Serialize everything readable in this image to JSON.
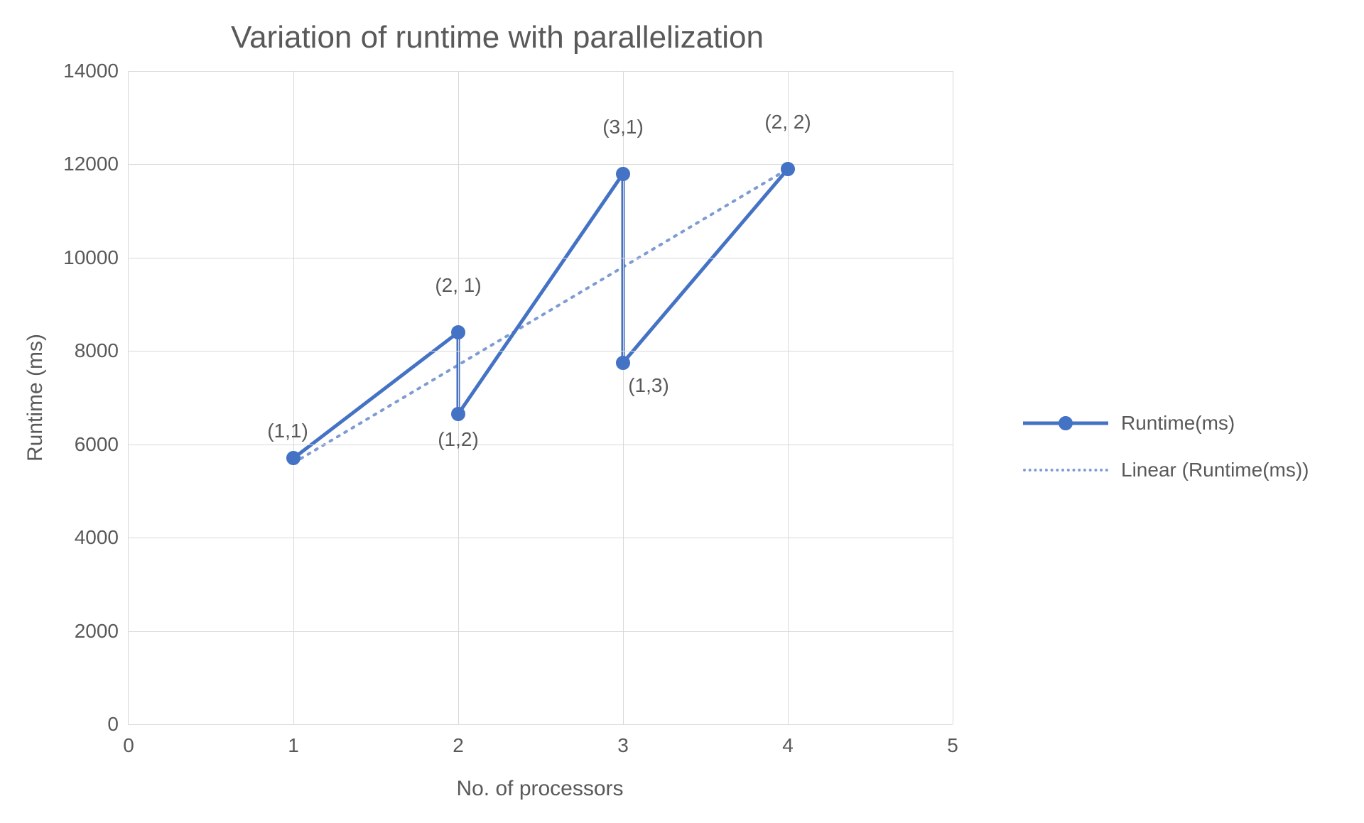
{
  "chart_data": {
    "type": "line",
    "title": "Variation of runtime with parallelization",
    "xlabel": "No. of processors",
    "ylabel": "Runtime (ms)",
    "xlim": [
      0,
      5
    ],
    "ylim": [
      0,
      14000
    ],
    "x_ticks": [
      0,
      1,
      2,
      3,
      4,
      5
    ],
    "y_ticks": [
      0,
      2000,
      4000,
      6000,
      8000,
      10000,
      12000,
      14000
    ],
    "series": [
      {
        "name": "Runtime(ms)",
        "style": "solid_markers",
        "color": "#4472c4",
        "points": [
          {
            "x": 1,
            "y": 5700,
            "label": "(1,1)",
            "label_pos": "above-left"
          },
          {
            "x": 2,
            "y": 8400,
            "label": "(2, 1)",
            "label_pos": "above"
          },
          {
            "x": 2,
            "y": 6650,
            "label": "(1,2)",
            "label_pos": "below"
          },
          {
            "x": 3,
            "y": 11800,
            "label": "(3,1)",
            "label_pos": "above"
          },
          {
            "x": 3,
            "y": 7750,
            "label": "(1,3)",
            "label_pos": "below-right"
          },
          {
            "x": 4,
            "y": 11900,
            "label": "(2, 2)",
            "label_pos": "above"
          }
        ]
      },
      {
        "name": "Linear (Runtime(ms))",
        "style": "dotted",
        "color": "#7e9bd3",
        "points": [
          {
            "x": 1,
            "y": 5600
          },
          {
            "x": 4,
            "y": 11900
          }
        ]
      }
    ]
  }
}
